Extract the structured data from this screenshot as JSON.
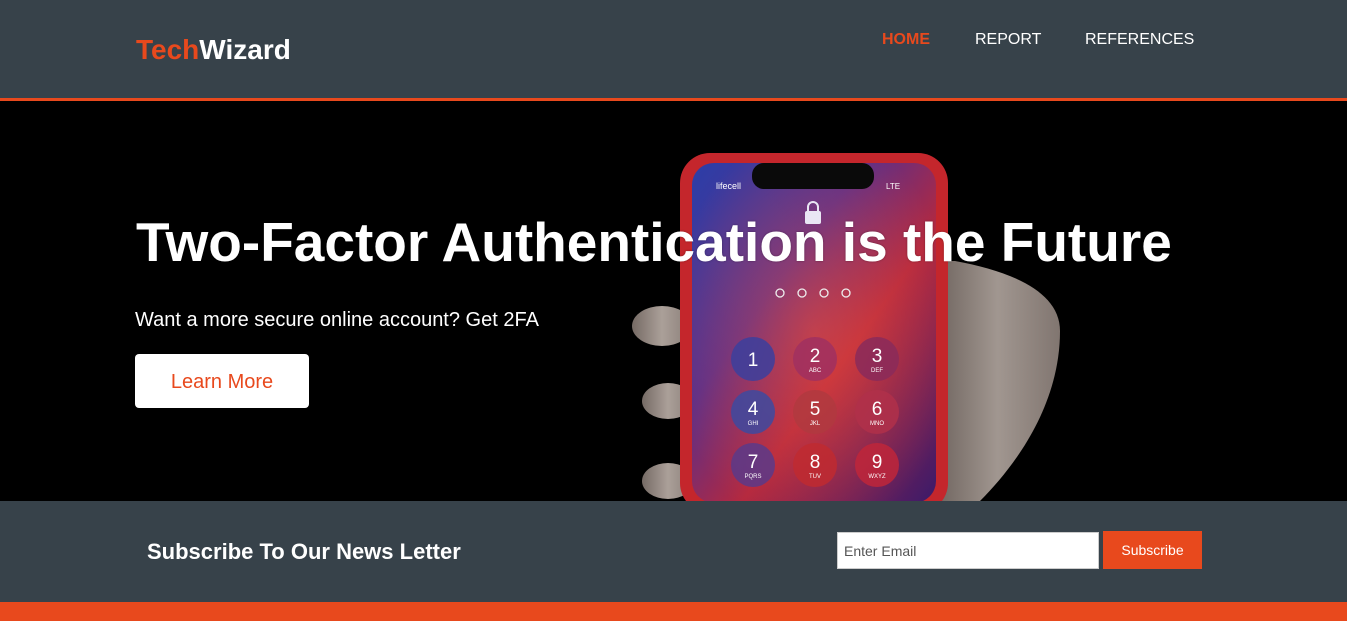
{
  "brand": {
    "highlight": "Tech",
    "rest": "Wizard"
  },
  "nav": {
    "home": "HOME",
    "report": "REPORT",
    "references": "REFERENCES"
  },
  "showcase": {
    "headline": "Two-Factor Authentication is the Future",
    "subline": "Want a more secure online account? Get 2FA",
    "cta_label": "Learn More"
  },
  "hero_image": {
    "carrier": "lifecell",
    "signal": "LTE",
    "keys": [
      {
        "digit": "1",
        "letters": ""
      },
      {
        "digit": "2",
        "letters": "ABC"
      },
      {
        "digit": "3",
        "letters": "DEF"
      },
      {
        "digit": "4",
        "letters": "GHI"
      },
      {
        "digit": "5",
        "letters": "JKL"
      },
      {
        "digit": "6",
        "letters": "MNO"
      },
      {
        "digit": "7",
        "letters": "PQRS"
      },
      {
        "digit": "8",
        "letters": "TUV"
      },
      {
        "digit": "9",
        "letters": "WXYZ"
      }
    ]
  },
  "newsletter": {
    "title": "Subscribe To Our News Letter",
    "email_placeholder": "Enter Email",
    "email_value": "",
    "button_label": "Subscribe"
  },
  "colors": {
    "accent": "#e8491d",
    "dark": "#37424a",
    "white": "#ffffff"
  }
}
